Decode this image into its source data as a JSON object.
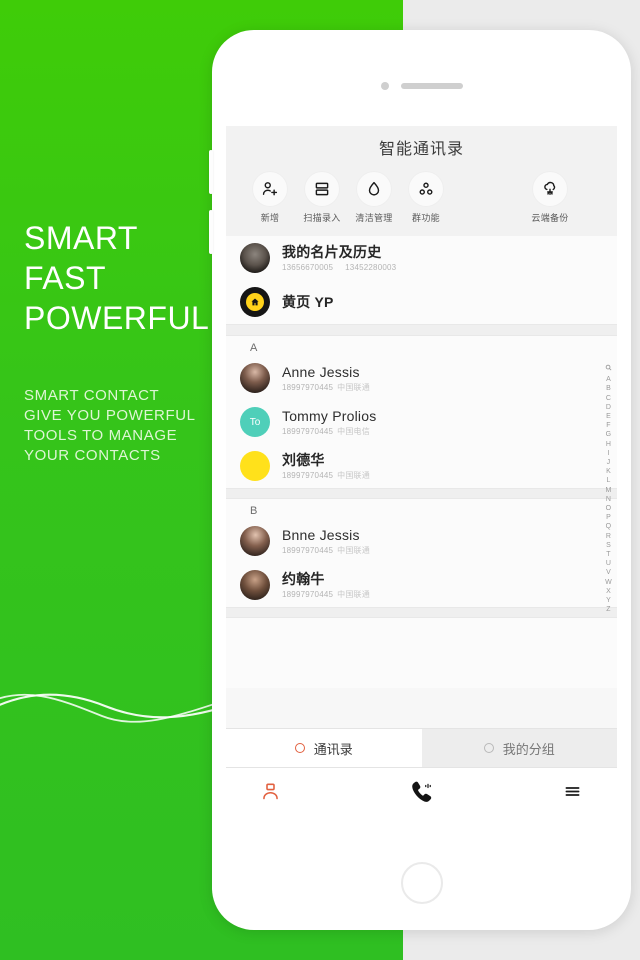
{
  "promo": {
    "headline": "SMART\nFAST\nPOWERFUL",
    "subtext": "SMART CONTACT\nGIVE YOU POWERFUL\nTOOLS TO MANAGE\nYOUR CONTACTS",
    "background_color": "#35c41a"
  },
  "app": {
    "title": "智能通讯录",
    "quick_actions": [
      {
        "label": "新增",
        "icon": "add-contact-icon"
      },
      {
        "label": "扫描录入",
        "icon": "scan-card-icon"
      },
      {
        "label": "清洁管理",
        "icon": "clean-drop-icon"
      },
      {
        "label": "群功能",
        "icon": "group-icon"
      },
      {
        "label": "云端备份",
        "icon": "cloud-backup-icon"
      }
    ],
    "top_entries": [
      {
        "name": "我的名片及历史",
        "phone1": "13656670005",
        "phone2": "13452280003",
        "avatar": "me-photo-avatar"
      },
      {
        "name": "黄页 YP",
        "avatar": "yellow-pages-home-avatar"
      }
    ],
    "sections": [
      {
        "letter": "A",
        "contacts": [
          {
            "name": "Anne Jessis",
            "phone": "18997970445",
            "carrier": "中国联通",
            "avatar": "anne-photo-avatar"
          },
          {
            "name": "Tommy Prolios",
            "phone": "18997970445",
            "carrier": "中国电信",
            "avatar": "initials-avatar",
            "initials": "To"
          },
          {
            "name": "刘德华",
            "phone": "18997970445",
            "carrier": "中国联通",
            "avatar": "blank-yellow-avatar"
          }
        ]
      },
      {
        "letter": "B",
        "contacts": [
          {
            "name": "Bnne Jessis",
            "phone": "18997970445",
            "carrier": "中国联通",
            "avatar": "bnne-photo-avatar"
          },
          {
            "name": "约翰牛",
            "phone": "18997970445",
            "carrier": "中国联通",
            "avatar": "john-photo-avatar"
          }
        ]
      }
    ],
    "index_bar": [
      "A",
      "B",
      "C",
      "D",
      "E",
      "F",
      "G",
      "H",
      "I",
      "J",
      "K",
      "L",
      "M",
      "N",
      "O",
      "P",
      "Q",
      "R",
      "S",
      "T",
      "U",
      "V",
      "W",
      "X",
      "Y",
      "Z"
    ],
    "index_search_icon": "search-icon",
    "segmented_tabs": [
      {
        "label": "通讯录",
        "active": true
      },
      {
        "label": "我的分组",
        "active": false
      }
    ],
    "nav_items": [
      {
        "icon": "contacts-icon",
        "active": true
      },
      {
        "icon": "dialer-phone-icon",
        "active": false
      },
      {
        "icon": "menu-hamburger-icon",
        "active": false
      }
    ],
    "accent_color": "#e2603f"
  }
}
